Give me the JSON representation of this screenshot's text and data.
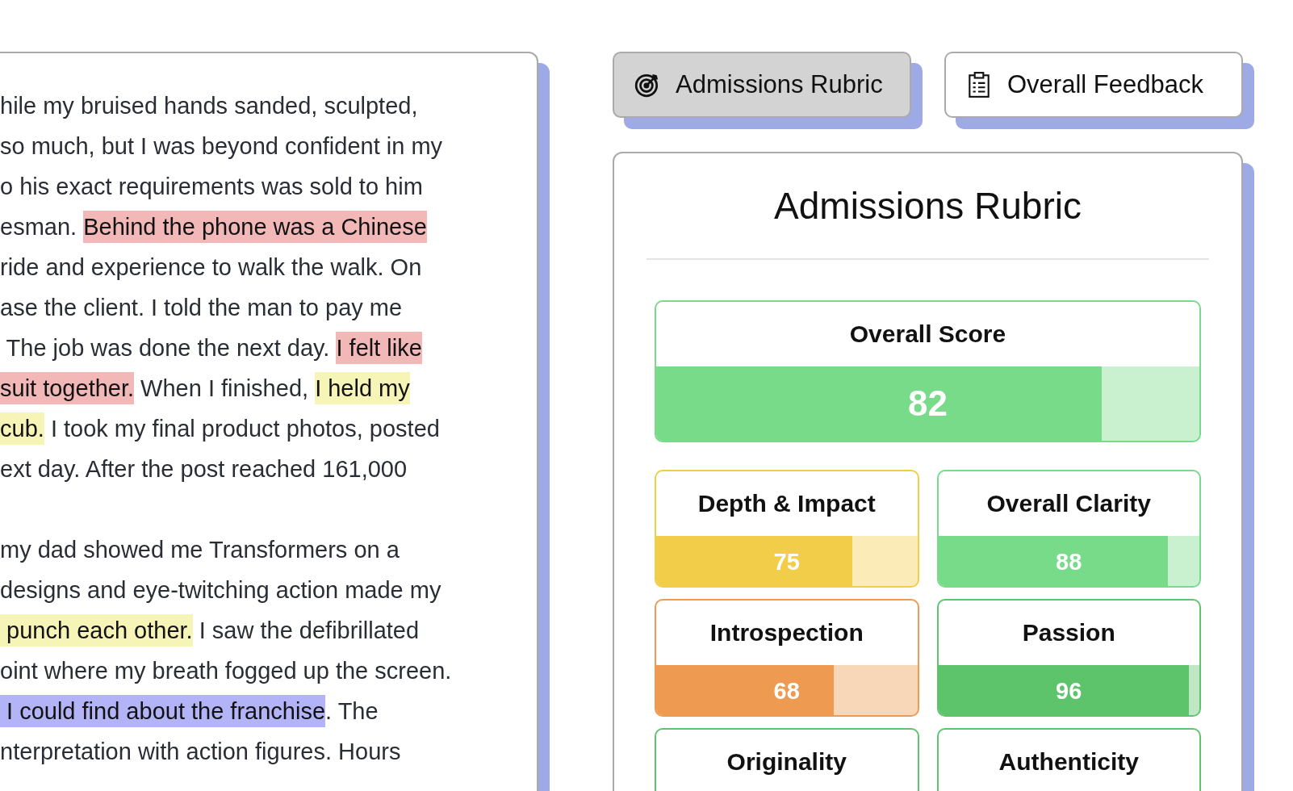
{
  "essay": {
    "paragraphs": [
      {
        "lines": [
          {
            "segments": [
              {
                "text": "hile my bruised hands sanded, sculpted,"
              }
            ]
          },
          {
            "segments": [
              {
                "text": "so much, but I was beyond confident in my"
              }
            ]
          },
          {
            "segments": [
              {
                "text": "o his exact requirements was sold to him"
              }
            ]
          },
          {
            "segments": [
              {
                "text": "esman. "
              },
              {
                "text": "Behind the phone was a Chinese",
                "color": "#f2b8b8"
              }
            ]
          },
          {
            "segments": [
              {
                "text": "ride and experience to walk the walk. On"
              }
            ]
          },
          {
            "segments": [
              {
                "text": "ase the client. I told the man to pay me"
              }
            ]
          },
          {
            "segments": [
              {
                "text": " The job was done the next day. "
              },
              {
                "text": "I felt like",
                "color": "#f2b8b8"
              }
            ]
          },
          {
            "segments": [
              {
                "text": "suit together.",
                "color": "#f2b8b8"
              },
              {
                "text": " When I finished, "
              },
              {
                "text": "I held my",
                "color": "#f7f4b8"
              }
            ]
          },
          {
            "segments": [
              {
                "text": "cub.",
                "color": "#f7f4b8"
              },
              {
                "text": " I took my final product photos, posted"
              }
            ]
          },
          {
            "segments": [
              {
                "text": "ext day. After the post reached 161,000"
              }
            ]
          }
        ]
      },
      {
        "lines": [
          {
            "segments": [
              {
                "text": "my dad showed me Transformers on a"
              }
            ]
          },
          {
            "segments": [
              {
                "text": "designs and eye-twitching action made my"
              }
            ]
          },
          {
            "segments": [
              {
                "text": " punch each other.",
                "color": "#f7f4b8"
              },
              {
                "text": " I saw the defibrillated"
              }
            ]
          },
          {
            "segments": [
              {
                "text": "oint where my breath fogged up the screen."
              }
            ]
          },
          {
            "segments": [
              {
                "text": " I could find about the franchise",
                "color": "#b3b3f7"
              },
              {
                "text": ". The"
              }
            ]
          },
          {
            "segments": [
              {
                "text": "nterpretation with action figures. Hours"
              }
            ]
          }
        ]
      }
    ]
  },
  "tabs": [
    {
      "label": "Admissions Rubric",
      "kind": "target",
      "selected": true
    },
    {
      "label": "Overall Feedback",
      "kind": "clipboard",
      "selected": false
    }
  ],
  "rubric": {
    "title": "Admissions Rubric",
    "overall": {
      "label": "Overall Score",
      "score": "82",
      "level": 0.82,
      "color": "#77db8a"
    },
    "criteria": [
      {
        "label": "Depth & Impact",
        "score": "75",
        "level": 0.75,
        "color": "#f2cd4a"
      },
      {
        "label": "Overall Clarity",
        "score": "88",
        "level": 0.88,
        "color": "#77db8a"
      },
      {
        "label": "Introspection",
        "score": "68",
        "level": 0.68,
        "color": "#ee9a50"
      },
      {
        "label": "Passion",
        "score": "96",
        "level": 0.96,
        "color": "#5ec46b"
      },
      {
        "label": "Originality",
        "color": "#5ec46b"
      },
      {
        "label": "Authenticity",
        "color": "#5ec46b"
      }
    ]
  }
}
